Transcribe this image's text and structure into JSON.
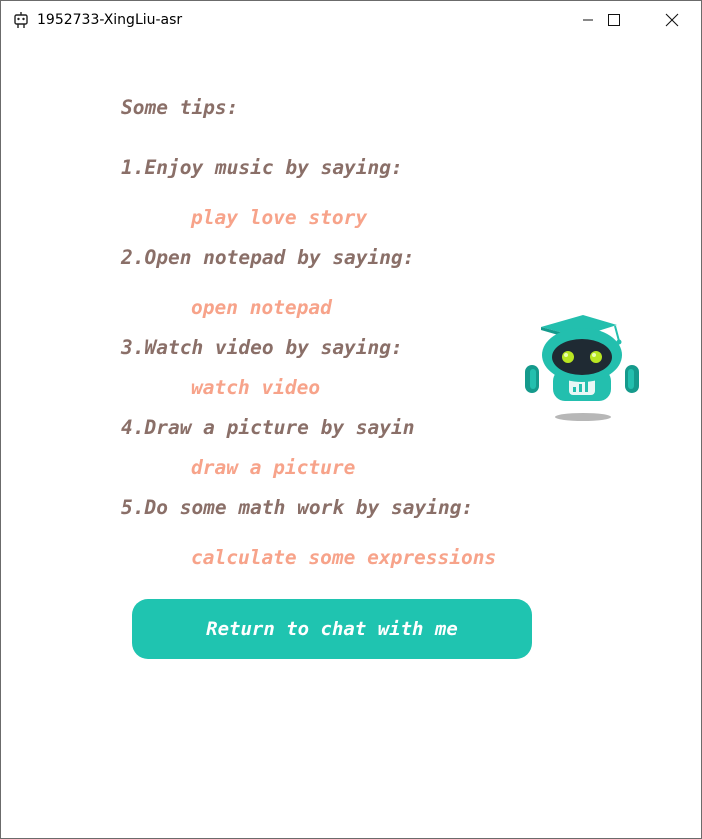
{
  "window": {
    "title": "1952733-XingLiu-asr"
  },
  "tips": {
    "heading": "Some tips:",
    "items": [
      {
        "label": "1.Enjoy music by saying:",
        "command": "play love story"
      },
      {
        "label": "2.Open notepad by saying:",
        "command": "open notepad"
      },
      {
        "label": "3.Watch video by saying:",
        "command": "watch video"
      },
      {
        "label": "4.Draw a picture by sayin",
        "command": "draw a picture"
      },
      {
        "label": "5.Do some math work by saying:",
        "command": "calculate some expressions"
      }
    ]
  },
  "robot": {
    "icon": "robot-mascot-icon"
  },
  "return_button": {
    "label": "Return to chat with me"
  },
  "colors": {
    "heading": "#8a6f68",
    "command": "#f7a38a",
    "button": "#1fc4b0"
  }
}
